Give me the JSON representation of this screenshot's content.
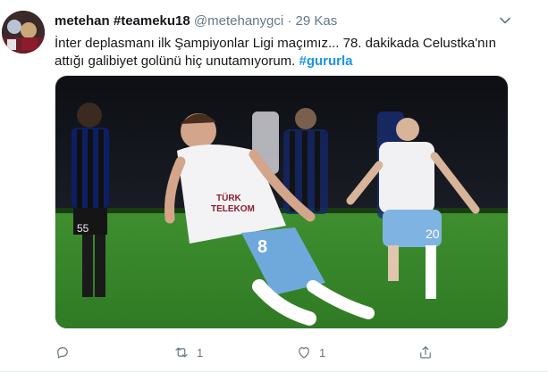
{
  "tweet": {
    "display_name": "metehan #teameku18",
    "handle": "@metehanygci",
    "separator": "·",
    "time": "29 Kas",
    "text": "İnter deplasmanı ilk Şampiyonlar Ligi maçımız... 78. dakikada Celustka'nın attığı galibiyet golünü hiç unutamıyorum.",
    "hashtag": "#gururla"
  },
  "media": {
    "shirt_sponsor_line1": "TÜRK",
    "shirt_sponsor_line2": "TELEKOM",
    "player_number": "8",
    "teammate_number": "20",
    "opponent_number": "55"
  },
  "actions": {
    "reply_count": "",
    "retweet_count": "1",
    "like_count": "1"
  },
  "colors": {
    "text": "#14171a",
    "muted": "#657786",
    "link": "#1b95e0"
  }
}
